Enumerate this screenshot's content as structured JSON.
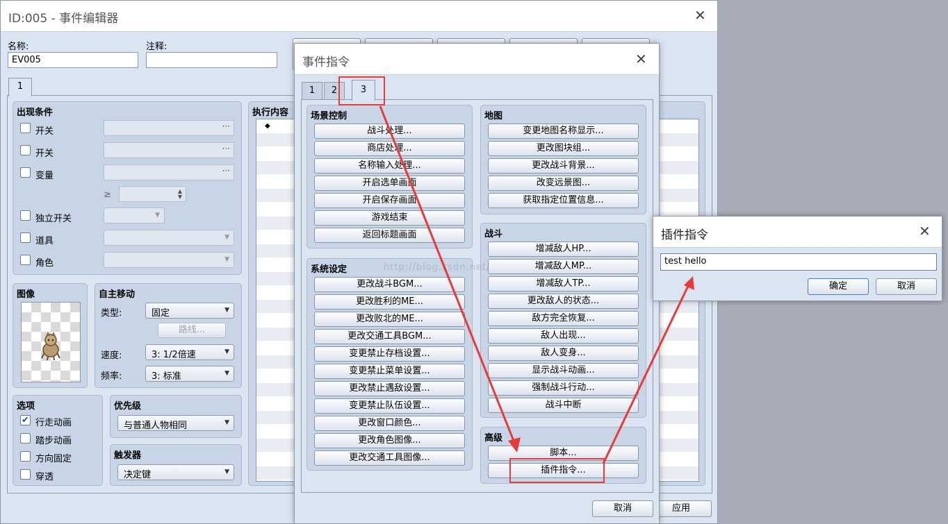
{
  "editor": {
    "title": "ID:005 - 事件编辑器",
    "name_label": "名称:",
    "name_value": "EV005",
    "note_label": "注释:",
    "note_value": "",
    "page_tab": "1",
    "cond": {
      "title": "出现条件",
      "switch1": "开关",
      "switch2": "开关",
      "variable": "变量",
      "ge": "≥",
      "self_switch": "独立开关",
      "item": "道具",
      "actor": "角色"
    },
    "image": {
      "title": "图像"
    },
    "move": {
      "title": "自主移动",
      "type_label": "类型:",
      "type_value": "固定",
      "route_btn": "路线...",
      "speed_label": "速度:",
      "speed_value": "3: 1/2倍速",
      "freq_label": "频率:",
      "freq_value": "3: 标准"
    },
    "options": {
      "title": "选项",
      "walk": "行走动画",
      "step": "踏步动画",
      "dirfix": "方向固定",
      "through": "穿透"
    },
    "priority": {
      "title": "优先级",
      "value": "与普通人物相同"
    },
    "trigger": {
      "title": "触发器",
      "value": "决定键"
    },
    "content": {
      "title": "执行内容",
      "marker": "◆"
    },
    "apply_btn": "应用"
  },
  "commands": {
    "title": "事件指令",
    "tabs": [
      "1",
      "2",
      "3"
    ],
    "scene": {
      "title": "场景控制",
      "items": [
        "战斗处理...",
        "商店处理...",
        "名称输入处理...",
        "开启选单画面",
        "开启保存画面",
        "游戏结束",
        "返回标题画面"
      ]
    },
    "system": {
      "title": "系统设定",
      "items": [
        "更改战斗BGM...",
        "更改胜利的ME...",
        "更改败北的ME...",
        "更改交通工具BGM...",
        "变更禁止存档设置...",
        "变更禁止菜单设置...",
        "更改禁止遇敌设置...",
        "变更禁止队伍设置...",
        "更改窗口颜色...",
        "更改角色图像...",
        "更改交通工具图像..."
      ]
    },
    "map": {
      "title": "地图",
      "items": [
        "变更地图名称显示...",
        "更改图块组...",
        "更改战斗背景...",
        "改变远景图...",
        "获取指定位置信息..."
      ]
    },
    "battle": {
      "title": "战斗",
      "items": [
        "增减敌人HP...",
        "增减敌人MP...",
        "增减敌人TP...",
        "更改敌人的状态...",
        "敌方完全恢复...",
        "敌人出现...",
        "敌人变身...",
        "显示战斗动画...",
        "强制战斗行动...",
        "战斗中断"
      ]
    },
    "advanced": {
      "title": "高级",
      "items": [
        "脚本...",
        "插件指令..."
      ]
    },
    "cancel_btn": "取消"
  },
  "plugin": {
    "title": "插件指令",
    "input_value": "test hello",
    "ok_btn": "确定",
    "cancel_btn": "取消"
  },
  "watermark": "http://blog.csdn.net/",
  "annotation_color": "#e83a3a"
}
